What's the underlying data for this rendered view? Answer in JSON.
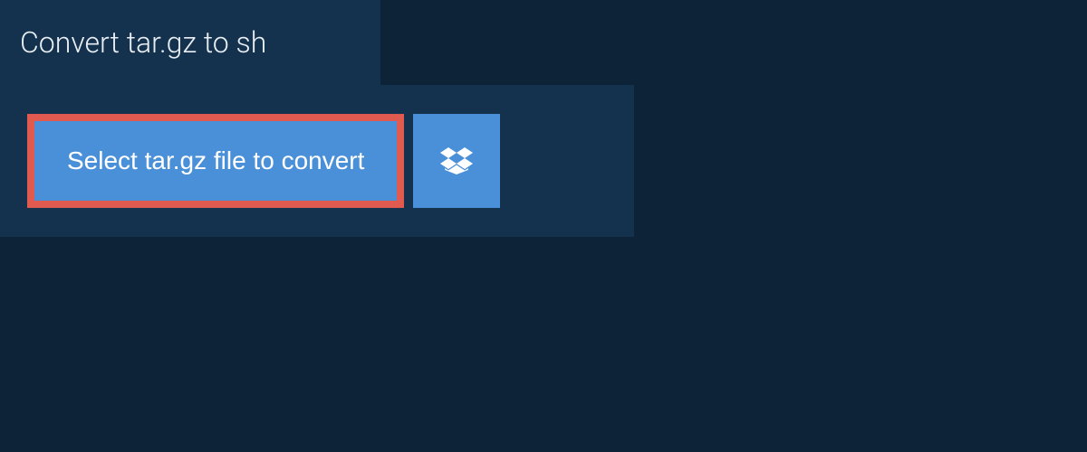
{
  "header": {
    "title": "Convert tar.gz to sh"
  },
  "actions": {
    "select_file_label": "Select tar.gz file to convert",
    "dropbox_icon": "dropbox-icon"
  },
  "colors": {
    "background": "#0d2438",
    "panel": "#14324d",
    "button": "#4a90d9",
    "highlight_border": "#e05a4f",
    "text_light": "#e8eef3"
  }
}
